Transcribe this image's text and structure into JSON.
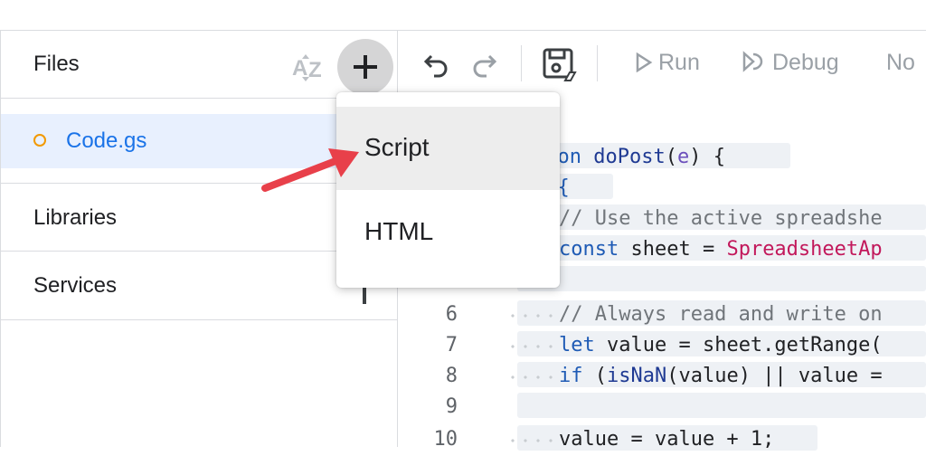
{
  "sidebar": {
    "files_title": "Files",
    "file": {
      "name": "Code.gs"
    },
    "sections": {
      "libraries": "Libraries",
      "services": "Services"
    }
  },
  "toolbar": {
    "run_label": "Run",
    "debug_label": "Debug",
    "overflow_label": "No"
  },
  "menu": {
    "script": "Script",
    "html": "HTML"
  },
  "editor": {
    "lines": {
      "l1": {
        "p1": "tion ",
        "p2": "doPost",
        "p3": "(",
        "p4": "e",
        "p5": ") {"
      },
      "l2": {
        "p1": "y {"
      },
      "l3": {
        "p1": "// Use the active spreadshe"
      },
      "l4": {
        "p1": "const",
        "p2": " sheet = ",
        "p3": "SpreadsheetAp"
      },
      "l6": {
        "num": "6",
        "p1": "// Always read and write on"
      },
      "l7": {
        "num": "7",
        "p1": "let",
        "p2": " value = sheet.getRange("
      },
      "l8": {
        "num": "8",
        "p1": "if",
        "p2": " (",
        "p3": "isNaN",
        "p4": "(value) || value ="
      },
      "l9": {
        "num": "9"
      },
      "l10": {
        "num": "10",
        "p1": "value = value + 1;"
      }
    }
  },
  "colors": {
    "accent": "#1a73e8",
    "file_dot": "#f29900",
    "arrow": "#e8404a"
  }
}
